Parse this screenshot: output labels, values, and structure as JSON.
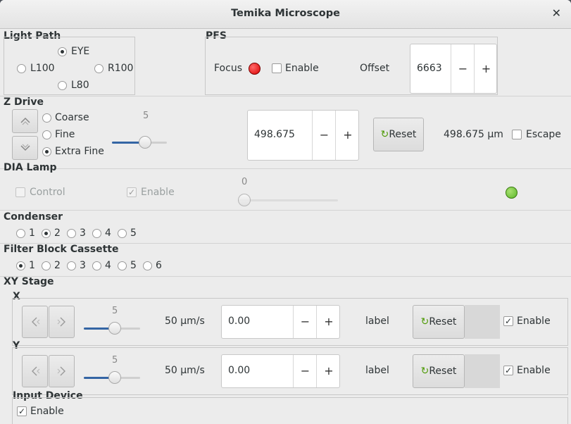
{
  "window": {
    "title": "Temika Microscope"
  },
  "light_path": {
    "header": "Light Path",
    "options": [
      "EYE",
      "L100",
      "R100",
      "L80"
    ],
    "selected": "EYE"
  },
  "pfs": {
    "header": "PFS",
    "focus_label": "Focus",
    "focus_led_color": "#dd0000",
    "enable_label": "Enable",
    "enable_checked": false,
    "offset_label": "Offset",
    "offset_value": "6663",
    "minus": "−",
    "plus": "+"
  },
  "z_drive": {
    "header": "Z Drive",
    "modes": [
      "Coarse",
      "Fine",
      "Extra Fine"
    ],
    "selected": "Extra Fine",
    "slider_value": "5",
    "slider_fraction": 0.6,
    "position_value": "498.675",
    "minus": "−",
    "plus": "+",
    "reset_label": "Reset",
    "readout": "498.675 µm",
    "escape_label": "Escape",
    "escape_checked": false
  },
  "dia_lamp": {
    "header": "DIA Lamp",
    "control_label": "Control",
    "enable_label": "Enable",
    "enable_checked": true,
    "slider_value": "0",
    "slider_fraction": 0,
    "led_color": "#5cb82a"
  },
  "condenser": {
    "header": "Condenser",
    "options": [
      "1",
      "2",
      "3",
      "4",
      "5"
    ],
    "selected": "2"
  },
  "filter_block": {
    "header": "Filter Block Cassette",
    "options": [
      "1",
      "2",
      "3",
      "4",
      "5",
      "6"
    ],
    "selected": "1"
  },
  "xy_stage": {
    "header": "XY Stage",
    "axes": [
      {
        "name": "X",
        "slider_value": "5",
        "slider_fraction": 0.55,
        "speed": "50 µm/s",
        "position": "0.00",
        "minus": "−",
        "plus": "+",
        "label": "label",
        "reset_label": "Reset",
        "enable_label": "Enable",
        "enable_checked": true
      },
      {
        "name": "Y",
        "slider_value": "5",
        "slider_fraction": 0.55,
        "speed": "50 µm/s",
        "position": "0.00",
        "minus": "−",
        "plus": "+",
        "label": "label",
        "reset_label": "Reset",
        "enable_label": "Enable",
        "enable_checked": true
      }
    ]
  },
  "input_device": {
    "header": "Input Device",
    "enable_label": "Enable",
    "enable_checked": true
  },
  "icons": {
    "close": "✕",
    "reset": "↻",
    "up": "chevron-up",
    "down": "chevron-down",
    "left": "chevron-left",
    "right": "chevron-right"
  }
}
